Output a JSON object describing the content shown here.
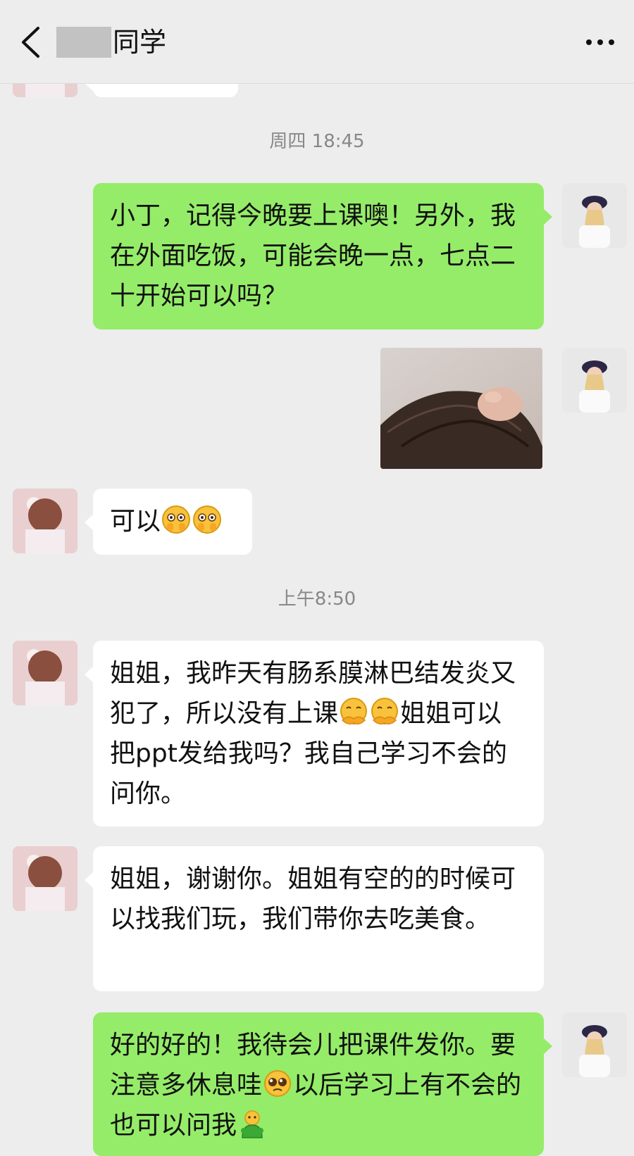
{
  "header": {
    "title": "同学",
    "back_icon": "chevron-left-icon",
    "more_icon": "more-horizontal-icon"
  },
  "colors": {
    "background": "#ededed",
    "bubble_out": "#95ec69",
    "bubble_in": "#ffffff",
    "timestamp": "#888888"
  },
  "timestamps": {
    "t1": "周四 18:45",
    "t2": "上午8:50"
  },
  "messages": {
    "m1": {
      "sender": "me",
      "text": "小丁，记得今晚要上课噢！另外，我在外面吃饭，可能会晚一点，七点二十开始可以吗？"
    },
    "m2": {
      "sender": "me",
      "kind": "image",
      "description_icon": "photo-hair-image"
    },
    "m3": {
      "sender": "other",
      "text": "可以",
      "emoji": [
        "peek-face-emoji",
        "peek-face-emoji"
      ]
    },
    "m4": {
      "sender": "other",
      "text_a": "姐姐，我昨天有肠系膜淋巴结发炎又犯了，所以没有上课",
      "emoji": [
        "hugging-face-emoji",
        "hugging-face-emoji"
      ],
      "text_b": "姐姐可以把ppt发给我吗？我自己学习不会的问你。"
    },
    "m5": {
      "sender": "other",
      "text": "姐姐，谢谢你。姐姐有空的的时候可以找我们玩，我们带你去吃美食。"
    },
    "m6": {
      "sender": "me",
      "text_a": "好的好的！我待会儿把课件发你。要注意多休息哇",
      "emoji_a": "pleading-face-emoji",
      "text_b": "以后学习上有不会的也可以问我",
      "emoji_b": "green-doll-emoji"
    }
  }
}
